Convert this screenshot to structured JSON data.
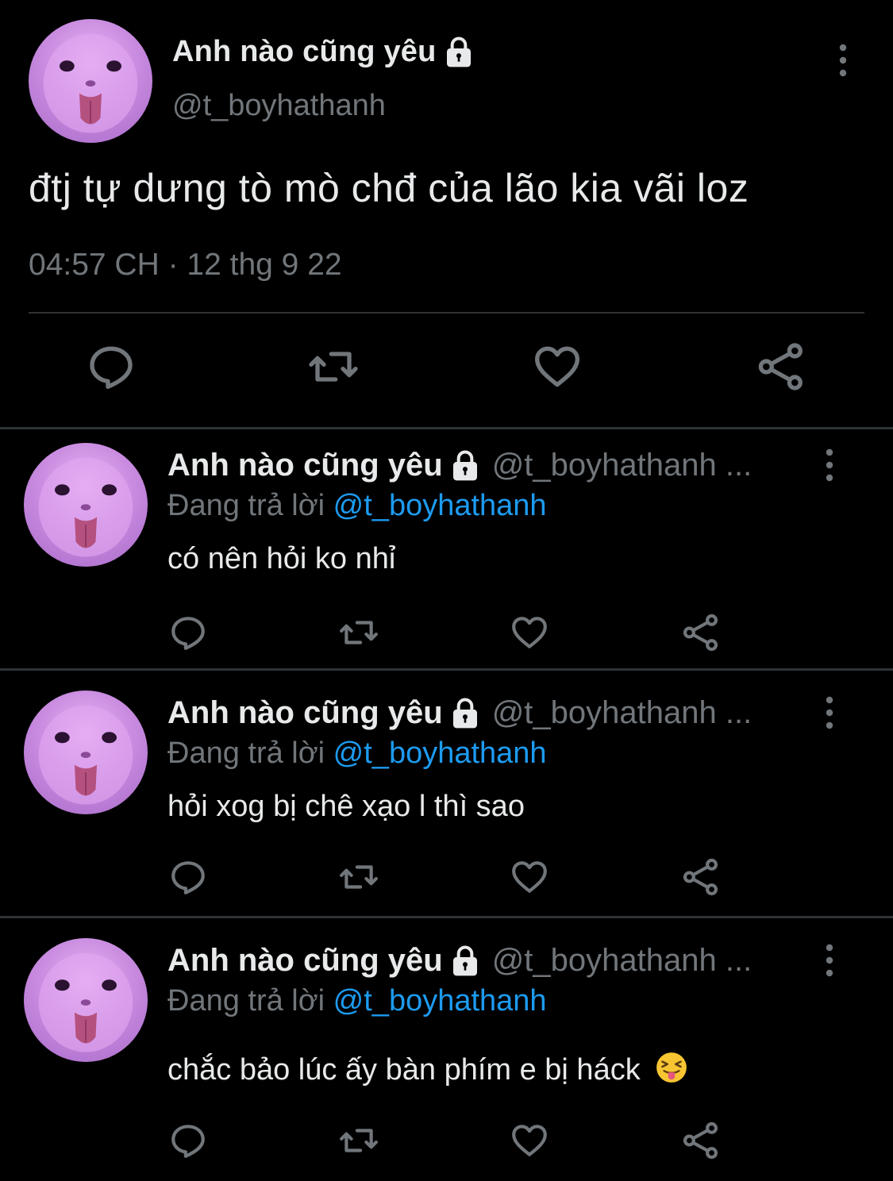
{
  "main_tweet": {
    "display_name": "Anh nào cũng yêu",
    "handle": "@t_boyhathanh",
    "text": "đtj tự dưng tò mò chđ của lão kia vãi loz",
    "timestamp": "04:57 CH · 12 thg 9 22",
    "icons": {
      "reply": "reply-icon",
      "retweet": "retweet-icon",
      "like": "heart-icon",
      "share": "share-icon",
      "more": "more-vertical-icon",
      "lock": "lock-icon"
    }
  },
  "replies": [
    {
      "display_name": "Anh nào cũng yêu",
      "handle": "@t_boyhathanh ...",
      "replying_label": "Đang trả lời",
      "replying_to": "@t_boyhathanh",
      "text": "có nên hỏi ko nhỉ"
    },
    {
      "display_name": "Anh nào cũng yêu",
      "handle": "@t_boyhathanh ...",
      "replying_label": "Đang trả lời",
      "replying_to": "@t_boyhathanh",
      "text": "hỏi xog bị chê xạo l thì sao"
    },
    {
      "display_name": "Anh nào cũng yêu",
      "handle": "@t_boyhathanh ...",
      "replying_label": "Đang trả lời",
      "replying_to": "@t_boyhathanh",
      "text": "chắc bảo lúc ấy bàn phím e bị háck",
      "emoji": "squinting-face-with-tongue-emoji"
    }
  ],
  "colors": {
    "background": "#000000",
    "primary_text": "#e7e9ea",
    "secondary_text": "#71767b",
    "mention": "#1d9bf0",
    "divider": "#2f3336",
    "avatar": "#c98ce0"
  }
}
